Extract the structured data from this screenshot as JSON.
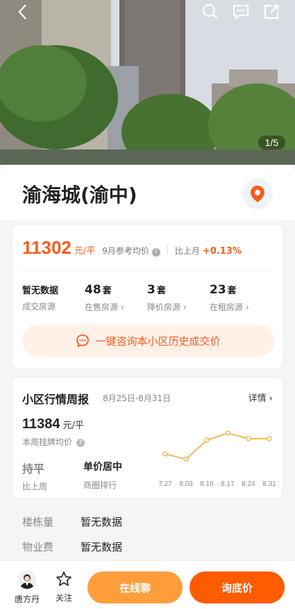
{
  "hero": {
    "image_counter": "1/5"
  },
  "title": "渝海城(渝中)",
  "price": {
    "value": "11302",
    "unit": "元/平",
    "ref_label": "9月参考均价",
    "mom_label": "比上月",
    "mom_value": "+0.13%"
  },
  "stats": [
    {
      "top": "暂无数据",
      "unit": "",
      "bottom": "成交房源",
      "arrow": ""
    },
    {
      "top": "48",
      "unit": "套",
      "bottom": "在售房源",
      "arrow": "›"
    },
    {
      "top": "3",
      "unit": "套",
      "bottom": "降价房源",
      "arrow": "›"
    },
    {
      "top": "23",
      "unit": "套",
      "bottom": "在租房源",
      "arrow": "›"
    }
  ],
  "consult_label": "一键咨询本小区历史成交价",
  "weekly": {
    "title": "小区行情周报",
    "date_range": "8月25日-8月31日",
    "detail_label": "详情",
    "price": "11384",
    "unit": "元/平",
    "sub_label": "本周挂牌均价",
    "trend_value": "持平",
    "trend_label": "比上周",
    "rank_value": "单价居中",
    "rank_label": "商圈排行"
  },
  "chart_data": {
    "type": "line",
    "x": [
      "7.27",
      "8.03",
      "8.10",
      "8.17",
      "8.24",
      "8.31"
    ],
    "series": [
      {
        "values": [
          11340,
          11325,
          11380,
          11400,
          11384,
          11384
        ]
      }
    ],
    "ylim": [
      11300,
      11420
    ],
    "color": "#f5b754"
  },
  "info": [
    {
      "key": "楼栋量",
      "value": "暂无数据"
    },
    {
      "key": "物业费",
      "value": "暂无数据"
    }
  ],
  "bottom": {
    "agent_name": "唐方丹",
    "follow_label": "关注",
    "chat_label": "在线聊",
    "price_label": "询底价"
  },
  "colors": {
    "accent": "#fa5c1c",
    "chat_button": "#ff9d3b",
    "price_button": "#ff5b00"
  },
  "icons": [
    "back-icon",
    "search-icon",
    "message-icon",
    "share-icon",
    "map-pin-icon",
    "question-icon",
    "chat-bubble-icon",
    "star-icon"
  ]
}
